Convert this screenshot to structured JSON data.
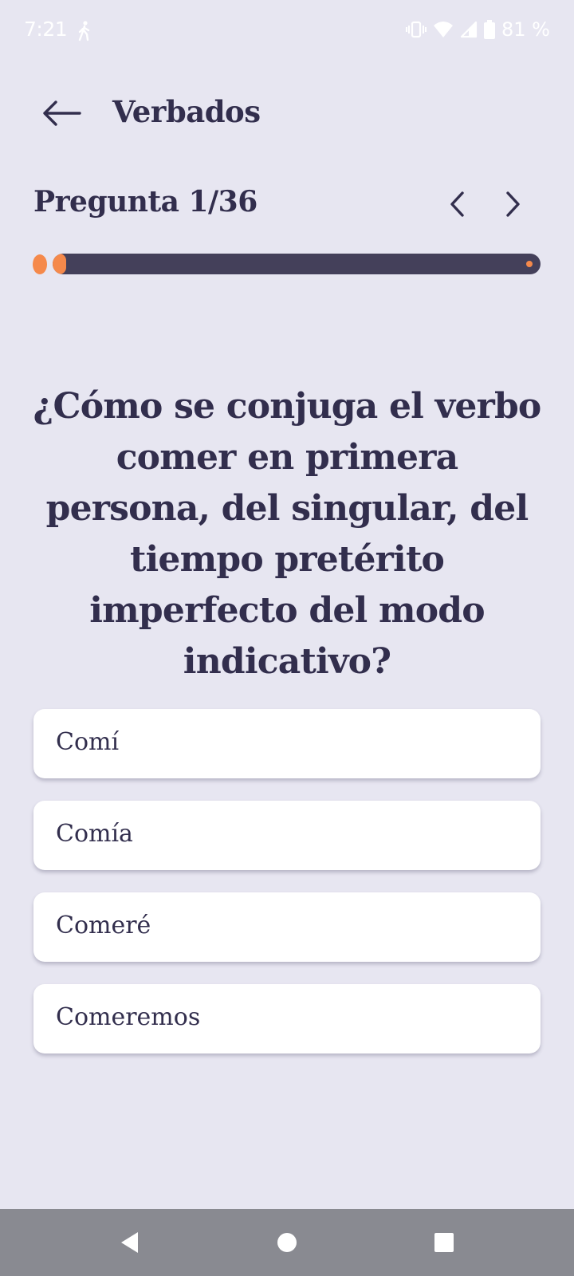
{
  "status_bar": {
    "time": "7:21",
    "battery_percent": "81 %",
    "icons": [
      "walking-icon",
      "vibrate-icon",
      "wifi-icon",
      "cell-signal-icon",
      "battery-icon"
    ]
  },
  "header": {
    "title": "Verbados",
    "back_icon": "arrow-left-icon"
  },
  "quiz": {
    "counter": "Pregunta 1/36",
    "current": 1,
    "total": 36,
    "progress_fraction": 0.028,
    "question": "¿Cómo se conjuga el verbo comer en primera persona, del singular, del tiempo pretérito imperfecto del modo indicativo?",
    "options": [
      {
        "label": "Comí"
      },
      {
        "label": "Comía"
      },
      {
        "label": "Comeré"
      },
      {
        "label": "Comeremos"
      }
    ]
  },
  "colors": {
    "background": "#e7e6f1",
    "text": "#322e4d",
    "accent": "#f5894b",
    "track": "#44405a",
    "card": "#ffffff",
    "system_nav": "#898a91"
  },
  "system_nav": {
    "icons": [
      "triangle-back-icon",
      "circle-home-icon",
      "square-recents-icon"
    ]
  }
}
